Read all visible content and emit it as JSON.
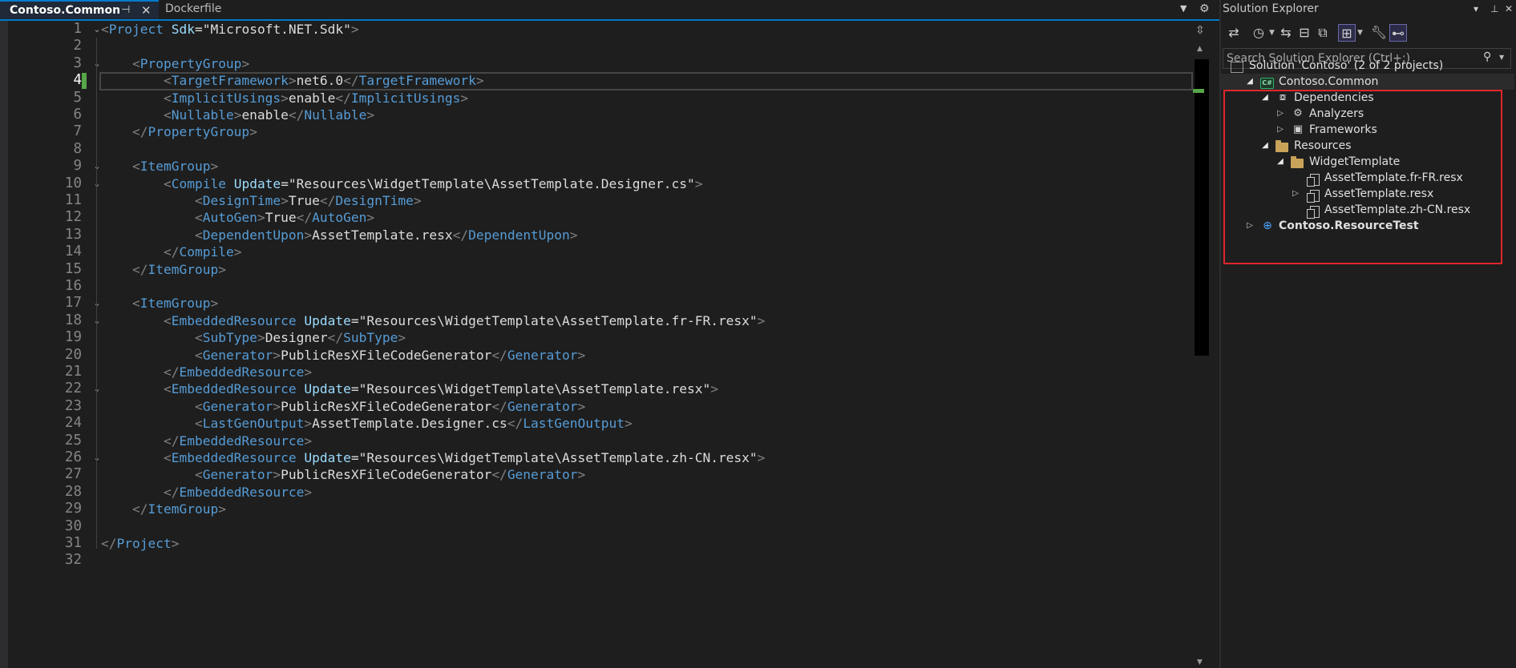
{
  "tabs": {
    "active": "Contoso.Common",
    "inactive": "Dockerfile",
    "pin_icon": "pin-icon",
    "close_icon": "close-icon",
    "menu_icon": "tab-list-icon",
    "settings_icon": "gear-icon"
  },
  "editor": {
    "current_line": 4,
    "lines": [
      {
        "n": "1",
        "fold": "⌄",
        "tokens": [
          {
            "t": "<",
            "c": "br"
          },
          {
            "t": "Project",
            "c": "tag"
          },
          {
            "t": " ",
            "c": "txt"
          },
          {
            "t": "Sdk",
            "c": "attr"
          },
          {
            "t": "=\"Microsoft.NET.Sdk\"",
            "c": "txt"
          },
          {
            "t": ">",
            "c": "br"
          }
        ]
      },
      {
        "n": "2",
        "fold": "",
        "tokens": []
      },
      {
        "n": "3",
        "fold": "⌄",
        "tokens": [
          {
            "t": "    ",
            "c": "txt"
          },
          {
            "t": "<",
            "c": "br"
          },
          {
            "t": "PropertyGroup",
            "c": "tag"
          },
          {
            "t": ">",
            "c": "br"
          }
        ]
      },
      {
        "n": "4",
        "fold": "",
        "tokens": [
          {
            "t": "        ",
            "c": "txt"
          },
          {
            "t": "<",
            "c": "br"
          },
          {
            "t": "TargetFramework",
            "c": "tag"
          },
          {
            "t": ">",
            "c": "br"
          },
          {
            "t": "net6.0",
            "c": "txt"
          },
          {
            "t": "</",
            "c": "br"
          },
          {
            "t": "TargetFramework",
            "c": "tag"
          },
          {
            "t": ">",
            "c": "br"
          }
        ]
      },
      {
        "n": "5",
        "fold": "",
        "tokens": [
          {
            "t": "        ",
            "c": "txt"
          },
          {
            "t": "<",
            "c": "br"
          },
          {
            "t": "ImplicitUsings",
            "c": "tag"
          },
          {
            "t": ">",
            "c": "br"
          },
          {
            "t": "enable",
            "c": "txt"
          },
          {
            "t": "</",
            "c": "br"
          },
          {
            "t": "ImplicitUsings",
            "c": "tag"
          },
          {
            "t": ">",
            "c": "br"
          }
        ]
      },
      {
        "n": "6",
        "fold": "",
        "tokens": [
          {
            "t": "        ",
            "c": "txt"
          },
          {
            "t": "<",
            "c": "br"
          },
          {
            "t": "Nullable",
            "c": "tag"
          },
          {
            "t": ">",
            "c": "br"
          },
          {
            "t": "enable",
            "c": "txt"
          },
          {
            "t": "</",
            "c": "br"
          },
          {
            "t": "Nullable",
            "c": "tag"
          },
          {
            "t": ">",
            "c": "br"
          }
        ]
      },
      {
        "n": "7",
        "fold": "",
        "tokens": [
          {
            "t": "    ",
            "c": "txt"
          },
          {
            "t": "</",
            "c": "br"
          },
          {
            "t": "PropertyGroup",
            "c": "tag"
          },
          {
            "t": ">",
            "c": "br"
          }
        ]
      },
      {
        "n": "8",
        "fold": "",
        "tokens": []
      },
      {
        "n": "9",
        "fold": "⌄",
        "tokens": [
          {
            "t": "    ",
            "c": "txt"
          },
          {
            "t": "<",
            "c": "br"
          },
          {
            "t": "ItemGroup",
            "c": "tag"
          },
          {
            "t": ">",
            "c": "br"
          }
        ]
      },
      {
        "n": "10",
        "fold": "⌄",
        "tokens": [
          {
            "t": "        ",
            "c": "txt"
          },
          {
            "t": "<",
            "c": "br"
          },
          {
            "t": "Compile",
            "c": "tag"
          },
          {
            "t": " ",
            "c": "txt"
          },
          {
            "t": "Update",
            "c": "attr"
          },
          {
            "t": "=\"Resources\\WidgetTemplate\\AssetTemplate.Designer.cs\"",
            "c": "txt"
          },
          {
            "t": ">",
            "c": "br"
          }
        ]
      },
      {
        "n": "11",
        "fold": "",
        "tokens": [
          {
            "t": "            ",
            "c": "txt"
          },
          {
            "t": "<",
            "c": "br"
          },
          {
            "t": "DesignTime",
            "c": "tag"
          },
          {
            "t": ">",
            "c": "br"
          },
          {
            "t": "True",
            "c": "txt"
          },
          {
            "t": "</",
            "c": "br"
          },
          {
            "t": "DesignTime",
            "c": "tag"
          },
          {
            "t": ">",
            "c": "br"
          }
        ]
      },
      {
        "n": "12",
        "fold": "",
        "tokens": [
          {
            "t": "            ",
            "c": "txt"
          },
          {
            "t": "<",
            "c": "br"
          },
          {
            "t": "AutoGen",
            "c": "tag"
          },
          {
            "t": ">",
            "c": "br"
          },
          {
            "t": "True",
            "c": "txt"
          },
          {
            "t": "</",
            "c": "br"
          },
          {
            "t": "AutoGen",
            "c": "tag"
          },
          {
            "t": ">",
            "c": "br"
          }
        ]
      },
      {
        "n": "13",
        "fold": "",
        "tokens": [
          {
            "t": "            ",
            "c": "txt"
          },
          {
            "t": "<",
            "c": "br"
          },
          {
            "t": "DependentUpon",
            "c": "tag"
          },
          {
            "t": ">",
            "c": "br"
          },
          {
            "t": "AssetTemplate.resx",
            "c": "txt"
          },
          {
            "t": "</",
            "c": "br"
          },
          {
            "t": "DependentUpon",
            "c": "tag"
          },
          {
            "t": ">",
            "c": "br"
          }
        ]
      },
      {
        "n": "14",
        "fold": "",
        "tokens": [
          {
            "t": "        ",
            "c": "txt"
          },
          {
            "t": "</",
            "c": "br"
          },
          {
            "t": "Compile",
            "c": "tag"
          },
          {
            "t": ">",
            "c": "br"
          }
        ]
      },
      {
        "n": "15",
        "fold": "",
        "tokens": [
          {
            "t": "    ",
            "c": "txt"
          },
          {
            "t": "</",
            "c": "br"
          },
          {
            "t": "ItemGroup",
            "c": "tag"
          },
          {
            "t": ">",
            "c": "br"
          }
        ]
      },
      {
        "n": "16",
        "fold": "",
        "tokens": []
      },
      {
        "n": "17",
        "fold": "⌄",
        "tokens": [
          {
            "t": "    ",
            "c": "txt"
          },
          {
            "t": "<",
            "c": "br"
          },
          {
            "t": "ItemGroup",
            "c": "tag"
          },
          {
            "t": ">",
            "c": "br"
          }
        ]
      },
      {
        "n": "18",
        "fold": "⌄",
        "tokens": [
          {
            "t": "        ",
            "c": "txt"
          },
          {
            "t": "<",
            "c": "br"
          },
          {
            "t": "EmbeddedResource",
            "c": "tag"
          },
          {
            "t": " ",
            "c": "txt"
          },
          {
            "t": "Update",
            "c": "attr"
          },
          {
            "t": "=\"Resources\\WidgetTemplate\\AssetTemplate.fr-FR.resx\"",
            "c": "txt"
          },
          {
            "t": ">",
            "c": "br"
          }
        ]
      },
      {
        "n": "19",
        "fold": "",
        "tokens": [
          {
            "t": "            ",
            "c": "txt"
          },
          {
            "t": "<",
            "c": "br"
          },
          {
            "t": "SubType",
            "c": "tag"
          },
          {
            "t": ">",
            "c": "br"
          },
          {
            "t": "Designer",
            "c": "txt"
          },
          {
            "t": "</",
            "c": "br"
          },
          {
            "t": "SubType",
            "c": "tag"
          },
          {
            "t": ">",
            "c": "br"
          }
        ]
      },
      {
        "n": "20",
        "fold": "",
        "tokens": [
          {
            "t": "            ",
            "c": "txt"
          },
          {
            "t": "<",
            "c": "br"
          },
          {
            "t": "Generator",
            "c": "tag"
          },
          {
            "t": ">",
            "c": "br"
          },
          {
            "t": "PublicResXFileCodeGenerator",
            "c": "txt"
          },
          {
            "t": "</",
            "c": "br"
          },
          {
            "t": "Generator",
            "c": "tag"
          },
          {
            "t": ">",
            "c": "br"
          }
        ]
      },
      {
        "n": "21",
        "fold": "",
        "tokens": [
          {
            "t": "        ",
            "c": "txt"
          },
          {
            "t": "</",
            "c": "br"
          },
          {
            "t": "EmbeddedResource",
            "c": "tag"
          },
          {
            "t": ">",
            "c": "br"
          }
        ]
      },
      {
        "n": "22",
        "fold": "⌄",
        "tokens": [
          {
            "t": "        ",
            "c": "txt"
          },
          {
            "t": "<",
            "c": "br"
          },
          {
            "t": "EmbeddedResource",
            "c": "tag"
          },
          {
            "t": " ",
            "c": "txt"
          },
          {
            "t": "Update",
            "c": "attr"
          },
          {
            "t": "=\"Resources\\WidgetTemplate\\AssetTemplate.resx\"",
            "c": "txt"
          },
          {
            "t": ">",
            "c": "br"
          }
        ]
      },
      {
        "n": "23",
        "fold": "",
        "tokens": [
          {
            "t": "            ",
            "c": "txt"
          },
          {
            "t": "<",
            "c": "br"
          },
          {
            "t": "Generator",
            "c": "tag"
          },
          {
            "t": ">",
            "c": "br"
          },
          {
            "t": "PublicResXFileCodeGenerator",
            "c": "txt"
          },
          {
            "t": "</",
            "c": "br"
          },
          {
            "t": "Generator",
            "c": "tag"
          },
          {
            "t": ">",
            "c": "br"
          }
        ]
      },
      {
        "n": "24",
        "fold": "",
        "tokens": [
          {
            "t": "            ",
            "c": "txt"
          },
          {
            "t": "<",
            "c": "br"
          },
          {
            "t": "LastGenOutput",
            "c": "tag"
          },
          {
            "t": ">",
            "c": "br"
          },
          {
            "t": "AssetTemplate.Designer.cs",
            "c": "txt"
          },
          {
            "t": "</",
            "c": "br"
          },
          {
            "t": "LastGenOutput",
            "c": "tag"
          },
          {
            "t": ">",
            "c": "br"
          }
        ]
      },
      {
        "n": "25",
        "fold": "",
        "tokens": [
          {
            "t": "        ",
            "c": "txt"
          },
          {
            "t": "</",
            "c": "br"
          },
          {
            "t": "EmbeddedResource",
            "c": "tag"
          },
          {
            "t": ">",
            "c": "br"
          }
        ]
      },
      {
        "n": "26",
        "fold": "⌄",
        "tokens": [
          {
            "t": "        ",
            "c": "txt"
          },
          {
            "t": "<",
            "c": "br"
          },
          {
            "t": "EmbeddedResource",
            "c": "tag"
          },
          {
            "t": " ",
            "c": "txt"
          },
          {
            "t": "Update",
            "c": "attr"
          },
          {
            "t": "=\"Resources\\WidgetTemplate\\AssetTemplate.zh-CN.resx\"",
            "c": "txt"
          },
          {
            "t": ">",
            "c": "br"
          }
        ]
      },
      {
        "n": "27",
        "fold": "",
        "tokens": [
          {
            "t": "            ",
            "c": "txt"
          },
          {
            "t": "<",
            "c": "br"
          },
          {
            "t": "Generator",
            "c": "tag"
          },
          {
            "t": ">",
            "c": "br"
          },
          {
            "t": "PublicResXFileCodeGenerator",
            "c": "txt"
          },
          {
            "t": "</",
            "c": "br"
          },
          {
            "t": "Generator",
            "c": "tag"
          },
          {
            "t": ">",
            "c": "br"
          }
        ]
      },
      {
        "n": "28",
        "fold": "",
        "tokens": [
          {
            "t": "        ",
            "c": "txt"
          },
          {
            "t": "</",
            "c": "br"
          },
          {
            "t": "EmbeddedResource",
            "c": "tag"
          },
          {
            "t": ">",
            "c": "br"
          }
        ]
      },
      {
        "n": "29",
        "fold": "",
        "tokens": [
          {
            "t": "    ",
            "c": "txt"
          },
          {
            "t": "</",
            "c": "br"
          },
          {
            "t": "ItemGroup",
            "c": "tag"
          },
          {
            "t": ">",
            "c": "br"
          }
        ]
      },
      {
        "n": "30",
        "fold": "",
        "tokens": []
      },
      {
        "n": "31",
        "fold": "",
        "tokens": [
          {
            "t": "</",
            "c": "br"
          },
          {
            "t": "Project",
            "c": "tag"
          },
          {
            "t": ">",
            "c": "br"
          }
        ]
      },
      {
        "n": "32",
        "fold": "",
        "tokens": []
      }
    ]
  },
  "solution_explorer": {
    "title": "Solution Explorer",
    "title_buttons": [
      "window-options-icon",
      "pin-icon",
      "close-icon"
    ],
    "search_placeholder": "Search Solution Explorer (Ctrl+;)",
    "toolbar": [
      "switch-views-icon",
      "history-icon",
      "sync-icon",
      "collapse-all-icon",
      "show-all-files-icon",
      "properties-icon",
      "preview-icon"
    ],
    "tree": [
      {
        "label": "Solution 'Contoso' (2 of 2 projects)",
        "icon": "solution-icon",
        "depth": 0,
        "toggle": "none",
        "bold": false
      },
      {
        "label": "Contoso.Common",
        "icon": "csharp-project-icon",
        "depth": 1,
        "toggle": "open",
        "bold": false,
        "selected": true
      },
      {
        "label": "Dependencies",
        "icon": "dependencies-icon",
        "depth": 2,
        "toggle": "open",
        "bold": false
      },
      {
        "label": "Analyzers",
        "icon": "analyzer-icon",
        "depth": 3,
        "toggle": "closed",
        "bold": false
      },
      {
        "label": "Frameworks",
        "icon": "framework-icon",
        "depth": 3,
        "toggle": "closed",
        "bold": false
      },
      {
        "label": "Resources",
        "icon": "folder-icon",
        "depth": 2,
        "toggle": "open",
        "bold": false
      },
      {
        "label": "WidgetTemplate",
        "icon": "folder-icon",
        "depth": 3,
        "toggle": "open",
        "bold": false
      },
      {
        "label": "AssetTemplate.fr-FR.resx",
        "icon": "resx-file-icon",
        "depth": 4,
        "toggle": "none",
        "bold": false
      },
      {
        "label": "AssetTemplate.resx",
        "icon": "resx-file-icon",
        "depth": 4,
        "toggle": "closed",
        "bold": false
      },
      {
        "label": "AssetTemplate.zh-CN.resx",
        "icon": "resx-file-icon",
        "depth": 4,
        "toggle": "none",
        "bold": false
      },
      {
        "label": "Contoso.ResourceTest",
        "icon": "web-project-icon",
        "depth": 1,
        "toggle": "closed",
        "bold": true
      }
    ]
  },
  "colors": {
    "background": "#1e1e1e",
    "tag": "#569cd6",
    "attribute": "#9cdcfe",
    "text": "#dcdcdc",
    "bracket": "#808080",
    "line_number": "#858585",
    "change_marker": "#57a64a",
    "highlight_box": "#e0262b",
    "accent": "#007acc"
  }
}
